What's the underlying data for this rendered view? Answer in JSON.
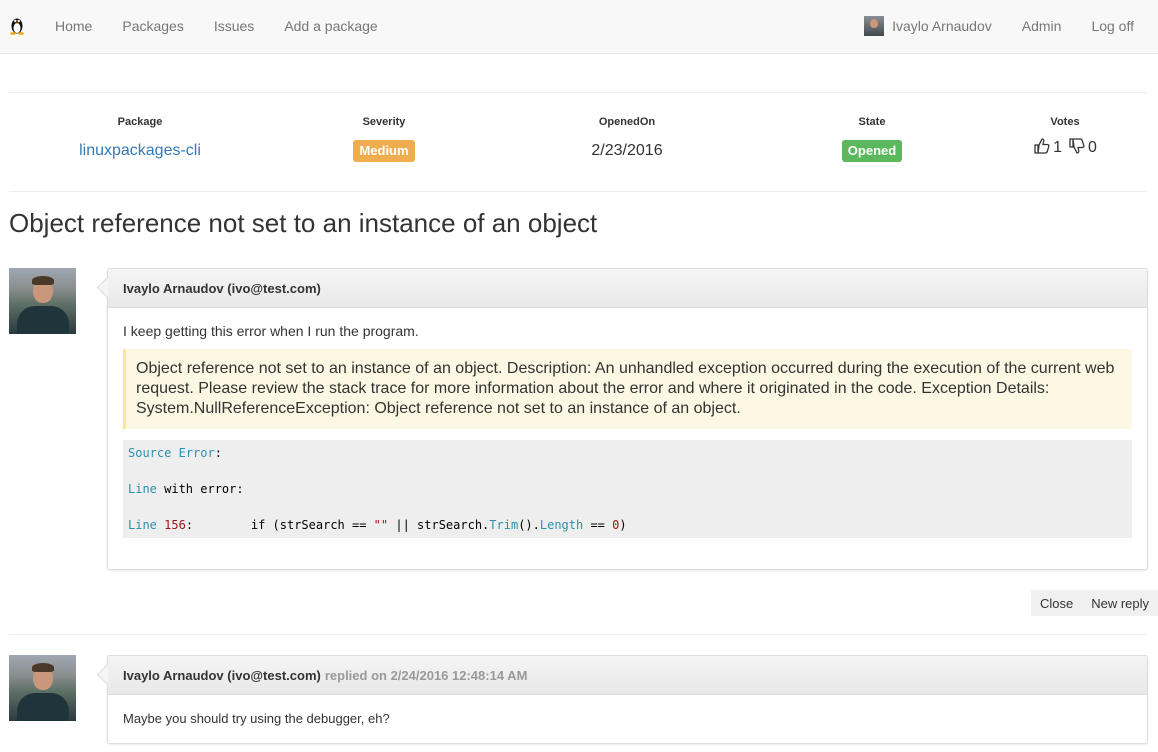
{
  "nav": {
    "brand_icon": "linux-tux-icon",
    "links": [
      "Home",
      "Packages",
      "Issues",
      "Add a package"
    ],
    "user_name": "Ivaylo Arnaudov",
    "admin": "Admin",
    "logoff": "Log off"
  },
  "issue": {
    "headers": {
      "package": "Package",
      "severity": "Severity",
      "opened_on": "OpenedOn",
      "state": "State",
      "votes": "Votes"
    },
    "package": "linuxpackages-cli",
    "severity": "Medium",
    "opened_on": "2/23/2016",
    "state": "Opened",
    "upvotes": "1",
    "downvotes": "0",
    "title": "Object reference not set to an instance of an object"
  },
  "comments": [
    {
      "author": "Ivaylo Arnaudov (ivo@test.com)",
      "text": "I keep getting this error when I run the program.",
      "quote": "Object reference not set to an instance of an object. Description: An unhandled exception occurred during the execution of the current web request. Please review the stack trace for more information about the error and where it originated in the code. Exception Details: System.NullReferenceException: Object reference not set to an instance of an object."
    },
    {
      "author": "Ivaylo Arnaudov (ivo@test.com)",
      "replied_on": "replied on 2/24/2016 12:48:14 AM",
      "text": "Maybe you should try using the debugger, eh?"
    }
  ],
  "actions": {
    "close": "Close",
    "new_reply": "New reply"
  },
  "colors": {
    "severity": "#f0ad4e",
    "state": "#5cb85c",
    "link": "#337ab7"
  }
}
